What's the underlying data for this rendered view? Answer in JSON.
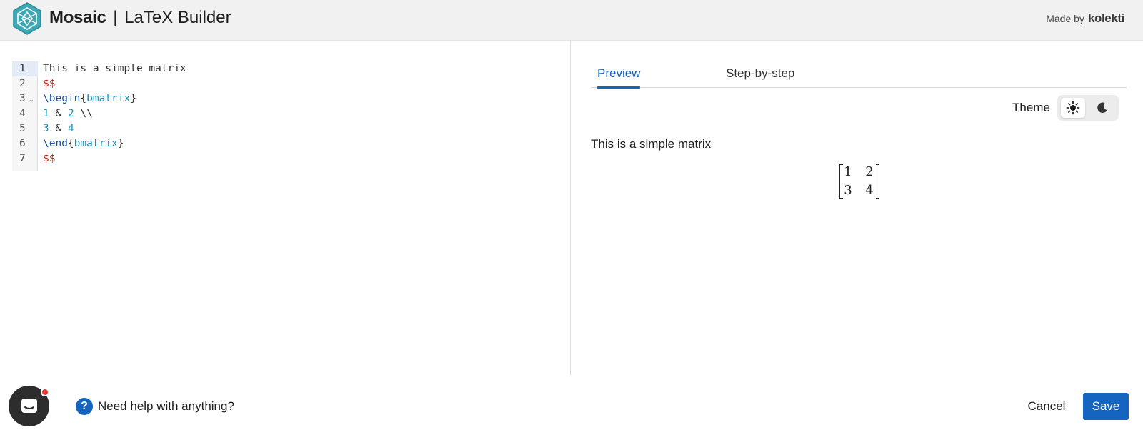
{
  "header": {
    "brand": "Mosaic",
    "separator": "|",
    "subtitle": "LaTeX Builder",
    "made_by_label": "Made by",
    "company": "kolekti",
    "logo_icon": "hexagon-logo-icon"
  },
  "editor": {
    "line_numbers": [
      "1",
      "2",
      "3",
      "4",
      "5",
      "6",
      "7"
    ],
    "active_line": 1,
    "fold_icon": "chevron-down-icon",
    "lines": [
      {
        "tokens": [
          {
            "text": "This is a simple matrix",
            "kind": "plain"
          }
        ]
      },
      {
        "tokens": [
          {
            "text": "$$",
            "kind": "dollar"
          }
        ]
      },
      {
        "tokens": [
          {
            "text": "\\begin",
            "kind": "cmd"
          },
          {
            "text": "{",
            "kind": "punct"
          },
          {
            "text": "bmatrix",
            "kind": "env"
          },
          {
            "text": "}",
            "kind": "punct"
          }
        ]
      },
      {
        "tokens": [
          {
            "text": "1",
            "kind": "num"
          },
          {
            "text": " & ",
            "kind": "punct"
          },
          {
            "text": "2",
            "kind": "num"
          },
          {
            "text": " \\\\",
            "kind": "punct"
          }
        ]
      },
      {
        "tokens": [
          {
            "text": "3",
            "kind": "num"
          },
          {
            "text": " & ",
            "kind": "punct"
          },
          {
            "text": "4",
            "kind": "num"
          }
        ]
      },
      {
        "tokens": [
          {
            "text": "\\end",
            "kind": "cmd"
          },
          {
            "text": "{",
            "kind": "punct"
          },
          {
            "text": "bmatrix",
            "kind": "env"
          },
          {
            "text": "}",
            "kind": "punct"
          }
        ]
      },
      {
        "tokens": [
          {
            "text": "$$",
            "kind": "dollar"
          }
        ]
      }
    ]
  },
  "tabs": {
    "preview": "Preview",
    "step_by_step": "Step-by-step",
    "active": "preview"
  },
  "theme": {
    "label": "Theme",
    "light_icon": "sun-icon",
    "dark_icon": "moon-icon",
    "selected": "light"
  },
  "preview": {
    "text": "This is a simple matrix",
    "matrix": [
      [
        "1",
        "2"
      ],
      [
        "3",
        "4"
      ]
    ]
  },
  "footer": {
    "chat_icon": "chat-bubble-icon",
    "help_icon": "question-icon",
    "help_glyph": "?",
    "help_text": "Need help with anything?",
    "cancel_label": "Cancel",
    "save_label": "Save"
  },
  "colors": {
    "accent": "#1565c0",
    "header_bg": "#f1f1f1",
    "latex_dollar": "#b3261e",
    "latex_command": "#1a4f9c",
    "latex_argument": "#1d8fb5",
    "notification_dot": "#e53935"
  }
}
